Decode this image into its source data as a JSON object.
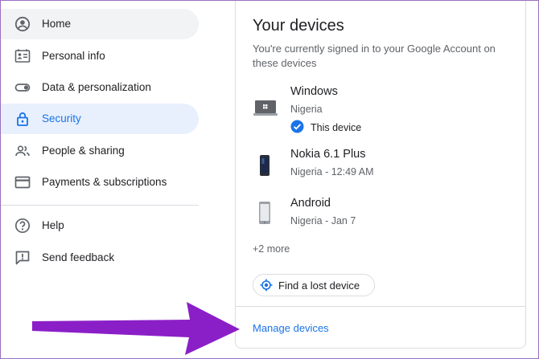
{
  "sidebar": {
    "items": [
      {
        "label": "Home",
        "icon": "account-circle-icon"
      },
      {
        "label": "Personal info",
        "icon": "id-card-icon"
      },
      {
        "label": "Data & personalization",
        "icon": "toggle-icon"
      },
      {
        "label": "Security",
        "icon": "lock-icon"
      },
      {
        "label": "People & sharing",
        "icon": "people-icon"
      },
      {
        "label": "Payments & subscriptions",
        "icon": "credit-card-icon"
      },
      {
        "label": "Help",
        "icon": "help-icon"
      },
      {
        "label": "Send feedback",
        "icon": "feedback-icon"
      }
    ],
    "active_item": "Security",
    "hovered_item": "Home"
  },
  "devices_card": {
    "title": "Your devices",
    "description": "You're currently signed in to your Google Account on these devices",
    "devices": [
      {
        "name": "Windows",
        "detail": "Nigeria",
        "badge": "This device",
        "icon": "laptop-icon"
      },
      {
        "name": "Nokia 6.1 Plus",
        "detail": "Nigeria - 12:49 AM",
        "icon": "phone-icon"
      },
      {
        "name": "Android",
        "detail": "Nigeria - Jan 7",
        "icon": "phone-icon"
      }
    ],
    "more_link": "+2 more",
    "find_button": "Find a lost device",
    "manage_link": "Manage devices"
  },
  "colors": {
    "accent": "#1a73e8",
    "active_bg": "#e8f0fe",
    "hover_bg": "#f1f3f4",
    "annotation_arrow": "#8b1fc7"
  }
}
